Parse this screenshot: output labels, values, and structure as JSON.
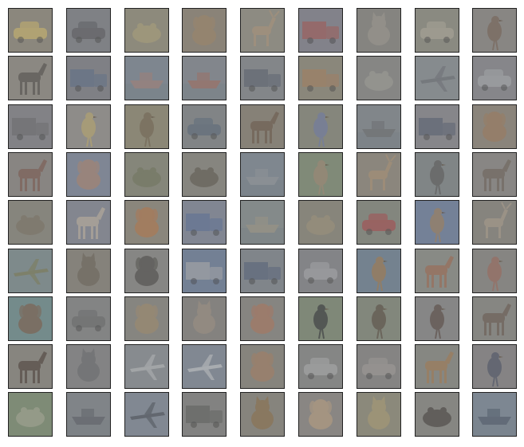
{
  "grid": {
    "rows": 9,
    "cols": 9,
    "tiles": [
      {
        "subject": "car-icon",
        "bg": "#8b877b",
        "fg": "#c9b46a"
      },
      {
        "subject": "car-icon",
        "bg": "#7d7f84",
        "fg": "#5c5d62"
      },
      {
        "subject": "frog-icon",
        "bg": "#8e8a79",
        "fg": "#a89f78"
      },
      {
        "subject": "dog-icon",
        "bg": "#8a8274",
        "fg": "#9c8466"
      },
      {
        "subject": "deer-icon",
        "bg": "#8e8c80",
        "fg": "#a8927a"
      },
      {
        "subject": "truck-icon",
        "bg": "#80808a",
        "fg": "#9e5a58"
      },
      {
        "subject": "cat-icon",
        "bg": "#84837e",
        "fg": "#9a968d"
      },
      {
        "subject": "automobile-icon",
        "bg": "#8a8a7f",
        "fg": "#aaa596"
      },
      {
        "subject": "bird-icon",
        "bg": "#888582",
        "fg": "#766457"
      },
      {
        "subject": "horse-icon",
        "bg": "#8b8880",
        "fg": "#55504c"
      },
      {
        "subject": "truck-icon",
        "bg": "#7d7e84",
        "fg": "#5f6f87"
      },
      {
        "subject": "ship-icon",
        "bg": "#7c8690",
        "fg": "#9e7e78"
      },
      {
        "subject": "ship-icon",
        "bg": "#80868d",
        "fg": "#9c6d62"
      },
      {
        "subject": "truck-icon",
        "bg": "#828589",
        "fg": "#5d6470"
      },
      {
        "subject": "truck-icon",
        "bg": "#8a8778",
        "fg": "#a27e5f"
      },
      {
        "subject": "frog-icon",
        "bg": "#858683",
        "fg": "#9b9a94"
      },
      {
        "subject": "airplane-icon",
        "bg": "#868b8f",
        "fg": "#6b6f75"
      },
      {
        "subject": "car-icon",
        "bg": "#85868a",
        "fg": "#a3a6aa"
      },
      {
        "subject": "truck-icon",
        "bg": "#808186",
        "fg": "#6c6c6f"
      },
      {
        "subject": "bird-icon",
        "bg": "#8f8d89",
        "fg": "#b8a56d"
      },
      {
        "subject": "bird-icon",
        "bg": "#8b8772",
        "fg": "#736651"
      },
      {
        "subject": "car-icon",
        "bg": "#7f8385",
        "fg": "#5c6a7a"
      },
      {
        "subject": "horse-icon",
        "bg": "#867f73",
        "fg": "#6c5a4c"
      },
      {
        "subject": "bird-icon",
        "bg": "#848679",
        "fg": "#6f7aa0"
      },
      {
        "subject": "ship-icon",
        "bg": "#7f858a",
        "fg": "#6a6d70"
      },
      {
        "subject": "truck-icon",
        "bg": "#86868a",
        "fg": "#5b6272"
      },
      {
        "subject": "dog-icon",
        "bg": "#8a8378",
        "fg": "#9b7a5c"
      },
      {
        "subject": "horse-icon",
        "bg": "#888480",
        "fg": "#7b5a50"
      },
      {
        "subject": "dog-icon",
        "bg": "#7d8696",
        "fg": "#a68370"
      },
      {
        "subject": "frog-icon",
        "bg": "#848677",
        "fg": "#72755d"
      },
      {
        "subject": "frog-icon",
        "bg": "#85847d",
        "fg": "#615c52"
      },
      {
        "subject": "ship-icon",
        "bg": "#7d8790",
        "fg": "#8f9499"
      },
      {
        "subject": "bird-icon",
        "bg": "#7e8a74",
        "fg": "#9c8872"
      },
      {
        "subject": "deer-icon",
        "bg": "#8b867b",
        "fg": "#a89073"
      },
      {
        "subject": "bird-icon",
        "bg": "#7e8485",
        "fg": "#5c5d5c"
      },
      {
        "subject": "horse-icon",
        "bg": "#888683",
        "fg": "#6e645a"
      },
      {
        "subject": "frog-icon",
        "bg": "#86847b",
        "fg": "#7b7365"
      },
      {
        "subject": "horse-icon",
        "bg": "#828690",
        "fg": "#b8ad9e"
      },
      {
        "subject": "dog-icon",
        "bg": "#8a8679",
        "fg": "#b0764c"
      },
      {
        "subject": "truck-icon",
        "bg": "#7f8594",
        "fg": "#5e7196"
      },
      {
        "subject": "ship-icon",
        "bg": "#838a8a",
        "fg": "#9a9585"
      },
      {
        "subject": "frog-icon",
        "bg": "#878478",
        "fg": "#9a9078"
      },
      {
        "subject": "car-icon",
        "bg": "#82857c",
        "fg": "#a44e4e"
      },
      {
        "subject": "bird-icon",
        "bg": "#6f7f9a",
        "fg": "#9a7e5e"
      },
      {
        "subject": "deer-icon",
        "bg": "#86837c",
        "fg": "#a69a8a"
      },
      {
        "subject": "airplane-icon",
        "bg": "#7c8a8c",
        "fg": "#7b7a56"
      },
      {
        "subject": "cat-icon",
        "bg": "#848178",
        "fg": "#6d655a"
      },
      {
        "subject": "dog-icon",
        "bg": "#868583",
        "fg": "#4f4d4a"
      },
      {
        "subject": "truck-icon",
        "bg": "#6e7e97",
        "fg": "#a2a6aa"
      },
      {
        "subject": "truck-icon",
        "bg": "#7e848a",
        "fg": "#58657a"
      },
      {
        "subject": "car-icon",
        "bg": "#828387",
        "fg": "#a3a5a8"
      },
      {
        "subject": "bird-icon",
        "bg": "#6f8190",
        "fg": "#9e7a50"
      },
      {
        "subject": "horse-icon",
        "bg": "#888a84",
        "fg": "#9b6b52"
      },
      {
        "subject": "bird-icon",
        "bg": "#858481",
        "fg": "#9a6a5c"
      },
      {
        "subject": "dog-icon",
        "bg": "#6f8c8c",
        "fg": "#7a5f4c"
      },
      {
        "subject": "car-icon",
        "bg": "#828383",
        "fg": "#6a6b6c"
      },
      {
        "subject": "dog-icon",
        "bg": "#86847e",
        "fg": "#9d8a6c"
      },
      {
        "subject": "cat-icon",
        "bg": "#83817d",
        "fg": "#9a8d80"
      },
      {
        "subject": "dog-icon",
        "bg": "#86847f",
        "fg": "#a8765e"
      },
      {
        "subject": "bird-icon",
        "bg": "#7d8874",
        "fg": "#35383a"
      },
      {
        "subject": "bird-icon",
        "bg": "#818779",
        "fg": "#5a4f44"
      },
      {
        "subject": "bird-icon",
        "bg": "#868685",
        "fg": "#5a4b46"
      },
      {
        "subject": "horse-icon",
        "bg": "#858580",
        "fg": "#6b5c52"
      },
      {
        "subject": "horse-icon",
        "bg": "#87847d",
        "fg": "#4f433c"
      },
      {
        "subject": "cat-icon",
        "bg": "#828283",
        "fg": "#6b6c6e"
      },
      {
        "subject": "airplane-icon",
        "bg": "#878c90",
        "fg": "#b3b6b8"
      },
      {
        "subject": "airplane-icon",
        "bg": "#7f8894",
        "fg": "#c0c3c6"
      },
      {
        "subject": "dog-icon",
        "bg": "#86837b",
        "fg": "#a17d62"
      },
      {
        "subject": "car-icon",
        "bg": "#848584",
        "fg": "#a7a8a9"
      },
      {
        "subject": "car-icon",
        "bg": "#848382",
        "fg": "#9c9995"
      },
      {
        "subject": "horse-icon",
        "bg": "#868780",
        "fg": "#a07a54"
      },
      {
        "subject": "bird-icon",
        "bg": "#848283",
        "fg": "#4f5566"
      },
      {
        "subject": "frog-icon",
        "bg": "#7c8c72",
        "fg": "#a0a590"
      },
      {
        "subject": "ship-icon",
        "bg": "#7e8388",
        "fg": "#5c6068"
      },
      {
        "subject": "airplane-icon",
        "bg": "#7f8894",
        "fg": "#4d535c"
      },
      {
        "subject": "truck-icon",
        "bg": "#81817f",
        "fg": "#606260"
      },
      {
        "subject": "cat-icon",
        "bg": "#86837b",
        "fg": "#8a6f4c"
      },
      {
        "subject": "dog-icon",
        "bg": "#898682",
        "fg": "#b59c7e"
      },
      {
        "subject": "cat-icon",
        "bg": "#8c8978",
        "fg": "#a79a72"
      },
      {
        "subject": "frog-icon",
        "bg": "#858580",
        "fg": "#4a4642"
      },
      {
        "subject": "ship-icon",
        "bg": "#7a8794",
        "fg": "#4e5a6a"
      }
    ]
  }
}
